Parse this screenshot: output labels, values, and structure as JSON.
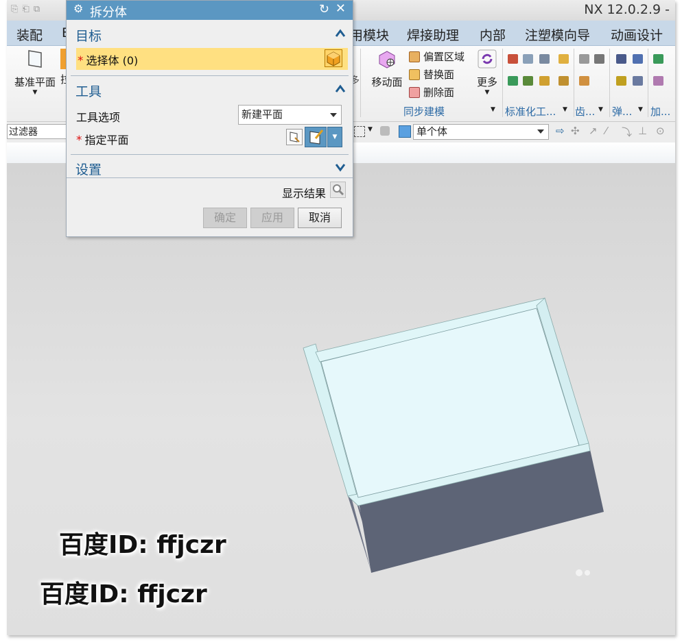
{
  "app": {
    "version_title": "NX 12.0.2.9 -"
  },
  "menubar": {
    "items": [
      "装配",
      "E",
      "用模块",
      "焊接助理",
      "内部",
      "注塑模向导",
      "动画设计"
    ]
  },
  "ribbon": {
    "datum_plane": "基准平面",
    "extrude_partial": "拉",
    "move_face": "移动面",
    "offset_region": "偏置区域",
    "replace_face": "替换面",
    "delete_face": "删除面",
    "more": "更多",
    "group_sync": "同步建模",
    "group_standard": "标准化工...",
    "group_gear": "齿...",
    "group_spring": "弹...",
    "group_add": "加..."
  },
  "selection_bar": {
    "filter": "过滤器",
    "scope": "单个体"
  },
  "dialog": {
    "title": "拆分体",
    "target_section": "目标",
    "select_body": "选择体 (0)",
    "tool_section": "工具",
    "tool_option_label": "工具选项",
    "tool_option_value": "新建平面",
    "specify_plane": "指定平面",
    "settings_section": "设置",
    "show_result": "显示结果",
    "ok": "确定",
    "apply": "应用",
    "cancel": "取消"
  },
  "watermarks": [
    "百度ID: ffjczr",
    "百度ID: ffjczr"
  ]
}
